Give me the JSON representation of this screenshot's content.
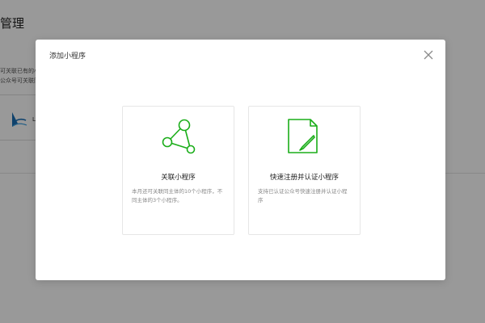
{
  "background": {
    "page_title": "管理",
    "desc_line1": "可关联已有的小程序",
    "desc_line2": "公众号可关联同主体",
    "logo_text": "L"
  },
  "dialog": {
    "title": "添加小程序",
    "close_icon": "close-icon",
    "options": [
      {
        "icon": "share-nodes-icon",
        "title": "关联小程序",
        "desc": "本月还可关联同主体的10个小程序，不同主体的3个小程序。"
      },
      {
        "icon": "document-edit-icon",
        "title": "快速注册并认证小程序",
        "desc": "支持已认证公众号快速注册并认证小程序"
      }
    ]
  },
  "colors": {
    "accent_green": "#1aad19",
    "overlay": "#000000"
  }
}
